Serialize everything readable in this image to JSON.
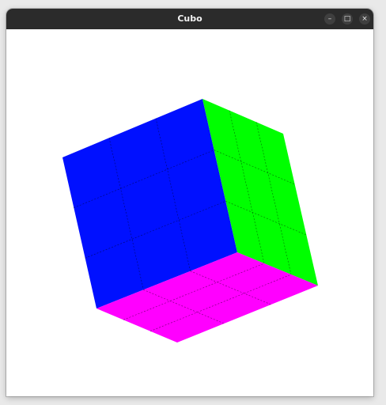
{
  "window": {
    "title": "Cubo",
    "controls": {
      "minimize_icon": "minimize-icon",
      "maximize_icon": "maximize-icon",
      "close_icon": "close-icon"
    }
  },
  "scene": {
    "background_color": "#ffffff",
    "faces": [
      {
        "name": "front",
        "color": "#0010ff",
        "grid": 3
      },
      {
        "name": "right",
        "color": "#00ff00",
        "grid": 3
      },
      {
        "name": "bottom",
        "color": "#ff00ff",
        "grid": 3
      }
    ],
    "grid_line_color": "#000000"
  }
}
